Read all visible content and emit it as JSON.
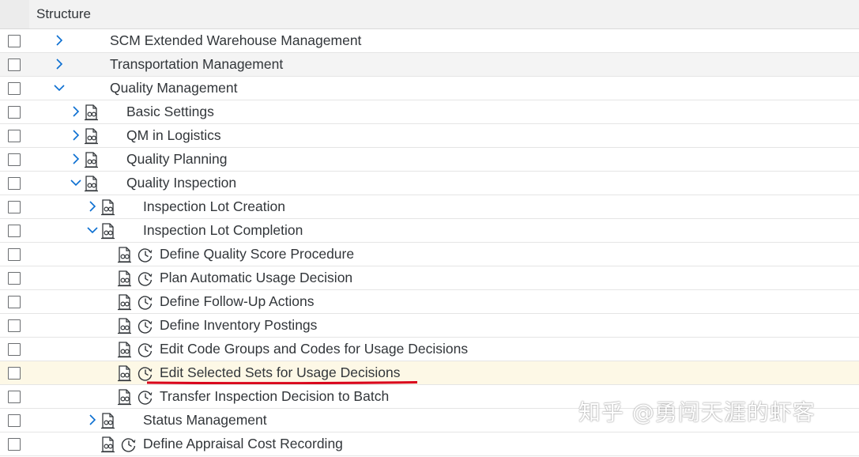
{
  "header": {
    "title": "Structure"
  },
  "rows": [
    {
      "label": "SCM Extended Warehouse Management",
      "expand": "collapsed",
      "level": 0,
      "doc": false,
      "clock": false,
      "alt": false
    },
    {
      "label": "Transportation Management",
      "expand": "collapsed",
      "level": 0,
      "doc": false,
      "clock": false,
      "alt": true
    },
    {
      "label": "Quality Management",
      "expand": "expanded",
      "level": 0,
      "doc": false,
      "clock": false,
      "alt": false
    },
    {
      "label": "Basic Settings",
      "expand": "collapsed",
      "level": 1,
      "doc": true,
      "clock": false,
      "alt": false
    },
    {
      "label": "QM in Logistics",
      "expand": "collapsed",
      "level": 1,
      "doc": true,
      "clock": false,
      "alt": false
    },
    {
      "label": "Quality Planning",
      "expand": "collapsed",
      "level": 1,
      "doc": true,
      "clock": false,
      "alt": false
    },
    {
      "label": "Quality Inspection",
      "expand": "expanded",
      "level": 1,
      "doc": true,
      "clock": false,
      "alt": false
    },
    {
      "label": "Inspection Lot Creation",
      "expand": "collapsed",
      "level": 2,
      "doc": true,
      "clock": false,
      "alt": false
    },
    {
      "label": "Inspection Lot Completion",
      "expand": "expanded",
      "level": 2,
      "doc": true,
      "clock": false,
      "alt": false
    },
    {
      "label": "Define Quality Score Procedure",
      "expand": "none",
      "level": 3,
      "doc": true,
      "clock": true,
      "alt": false
    },
    {
      "label": "Plan Automatic Usage Decision",
      "expand": "none",
      "level": 3,
      "doc": true,
      "clock": true,
      "alt": false
    },
    {
      "label": "Define Follow-Up Actions",
      "expand": "none",
      "level": 3,
      "doc": true,
      "clock": true,
      "alt": false
    },
    {
      "label": "Define Inventory Postings",
      "expand": "none",
      "level": 3,
      "doc": true,
      "clock": true,
      "alt": false
    },
    {
      "label": "Edit Code Groups and Codes for Usage Decisions",
      "expand": "none",
      "level": 3,
      "doc": true,
      "clock": true,
      "alt": false
    },
    {
      "label": "Edit Selected Sets for Usage Decisions",
      "expand": "none",
      "level": 3,
      "doc": true,
      "clock": true,
      "alt": false,
      "highlight": true
    },
    {
      "label": "Transfer Inspection Decision to Batch",
      "expand": "none",
      "level": 3,
      "doc": true,
      "clock": true,
      "alt": false
    },
    {
      "label": "Status Management",
      "expand": "collapsed",
      "level": 2,
      "doc": true,
      "clock": false,
      "alt": false
    },
    {
      "label": "Define Appraisal Cost Recording",
      "expand": "none",
      "level": 2,
      "doc": true,
      "clock": true,
      "alt": false
    }
  ],
  "icons": {
    "expand": "chevron-right-icon",
    "collapse": "chevron-down-icon",
    "doc": "documentation-icon",
    "clock": "clock-icon"
  },
  "colors": {
    "accent": "#0a6ed1",
    "highlight_row": "#fdf8e6",
    "underline": "#d9001b"
  },
  "watermark": {
    "text": "知乎 @勇闯天涯的虾客"
  }
}
